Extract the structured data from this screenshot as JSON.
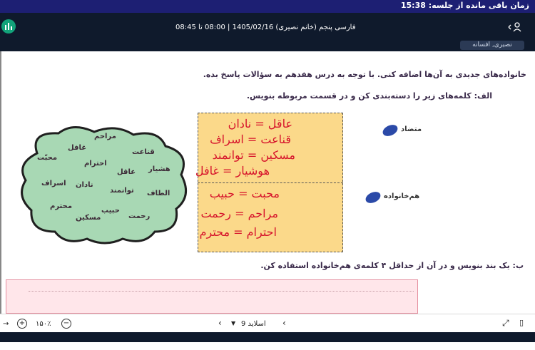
{
  "timer": {
    "text": "زمان باقی مانده از جلسه: 15:38"
  },
  "header": {
    "title": "فارسی پنجم (خانم نصیری) 1405/02/16 | 08:00 تا 08:45",
    "presenter": "نصیری, افسانه"
  },
  "page": {
    "intro": "خانواده‌های جدیدی به آن‌ها اضافه کنی. با توجه به درس هفدهم به سؤالات پاسخ بده.",
    "task_a": "الف: کلمه‌های زیر را دسته‌بندی کن و در قسمت مربوطه بنویس.",
    "label_opposite": "متضاد",
    "label_family": "هم‌خانواده",
    "task_b": "ب: یک بند بنویس و در آن از حداقل ۴ کلمه‌ی هم‌خانواده استفاده کن."
  },
  "cloud_words": [
    "مراحم",
    "قناعت",
    "غافل",
    "محبّت",
    "احترام",
    "هشیار",
    "عاقل",
    "اسراف",
    "نادان",
    "توانمند",
    "الطاف",
    "محترم",
    "حبیب",
    "رحمت",
    "مسکین"
  ],
  "handwriting": {
    "top": [
      "عاقل = نادان",
      "قناعت = اسراف",
      "مسکین = توانمند",
      "هوشیار = غافل"
    ],
    "bottom": [
      "محبت = حبیب",
      "مراحم = رحمت",
      "احترام = محترم"
    ]
  },
  "toolbar": {
    "zoom": "۱۵۰٪",
    "slide_label": "اسلاید 9"
  },
  "colors": {
    "header": "#0f1a2c",
    "timer_bar": "#1d1f73",
    "accent": "#12a37a",
    "ink": "#d6132b",
    "box": "#fbd98a"
  }
}
